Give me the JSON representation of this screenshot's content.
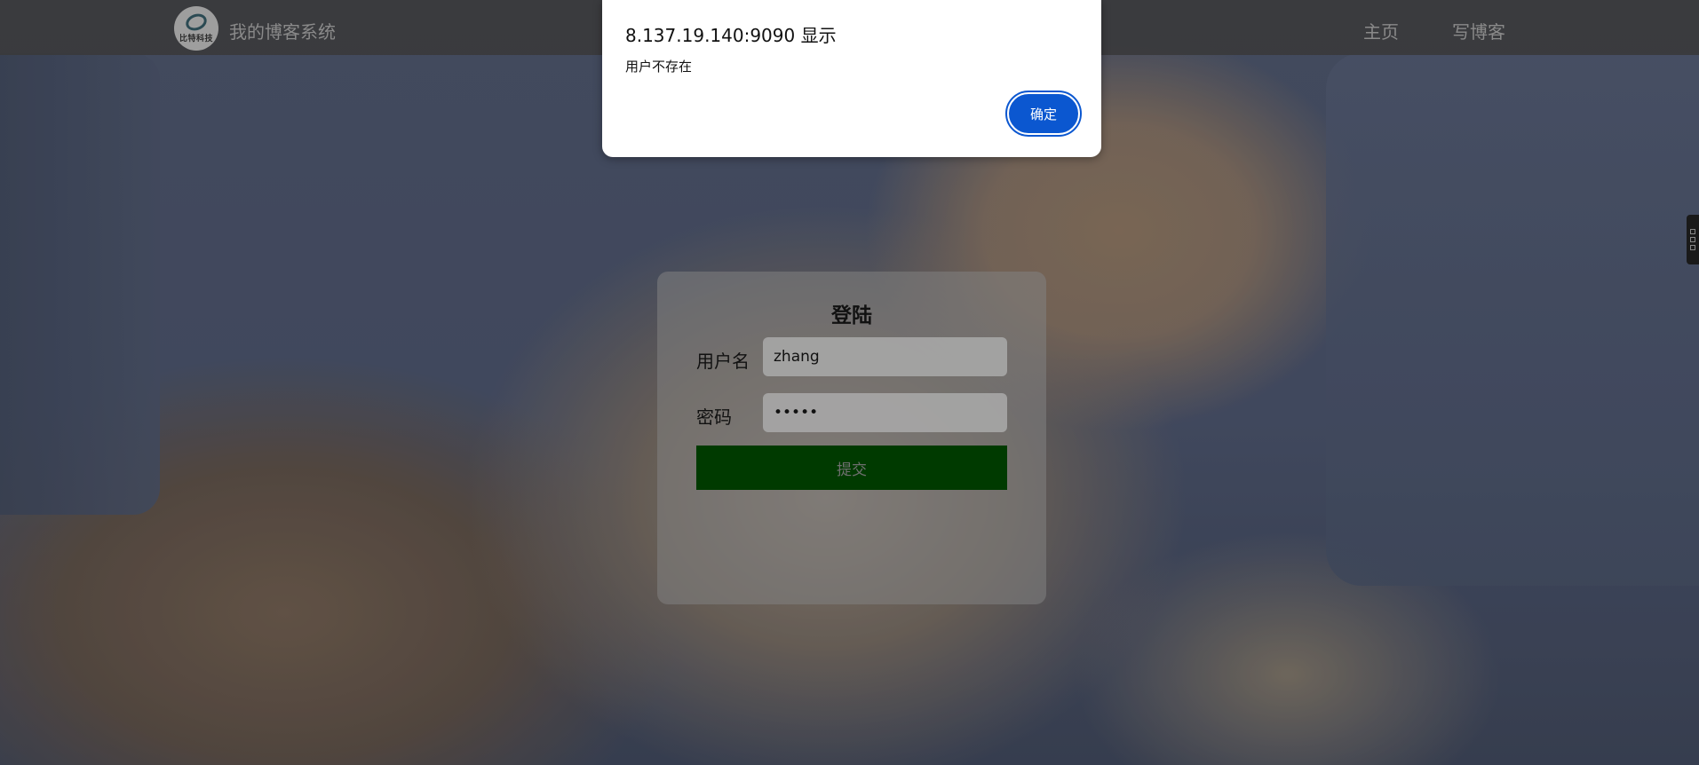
{
  "navbar": {
    "logo_text": "比特科技",
    "site_title": "我的博客系统",
    "links": [
      {
        "label": "主页"
      },
      {
        "label": "写博客"
      }
    ]
  },
  "login": {
    "title": "登陆",
    "username_label": "用户名",
    "username_value": "zhang",
    "password_label": "密码",
    "password_value": "•••••",
    "submit_label": "提交"
  },
  "dialog": {
    "title": "8.137.19.140:9090 显示",
    "message": "用户不存在",
    "ok_label": "确定"
  },
  "colors": {
    "submit_bg": "#003a00",
    "dialog_button": "#0b57d0",
    "navbar_bg": "#3a3a3c"
  }
}
